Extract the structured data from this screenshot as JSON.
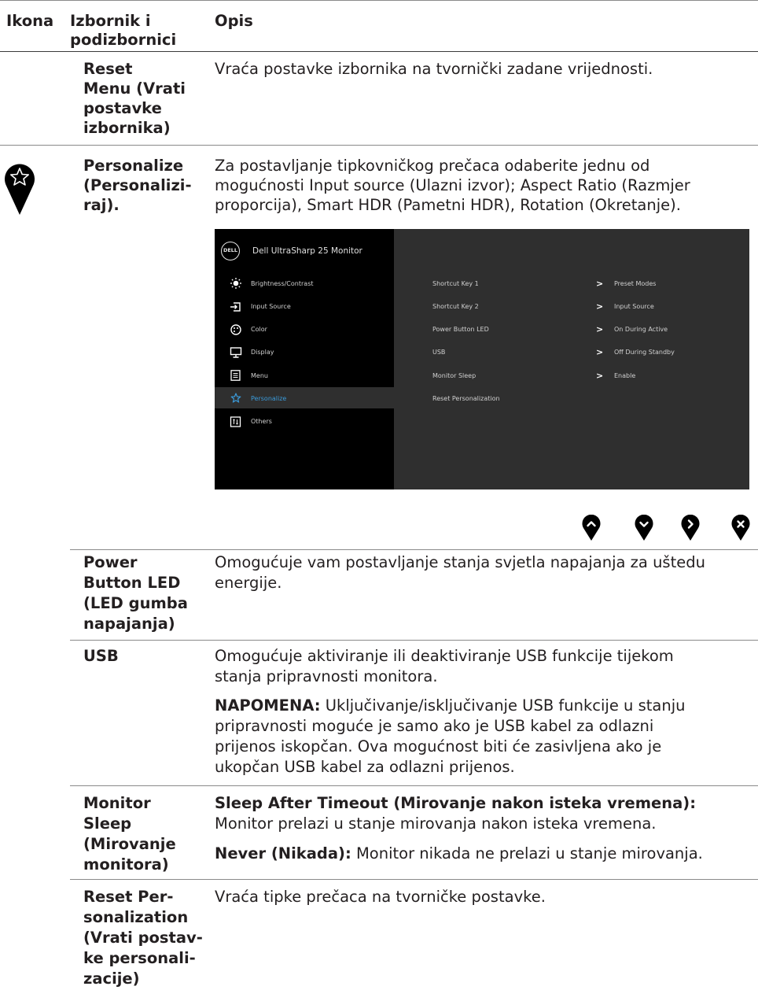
{
  "header": {
    "col_icon": "Ikona",
    "col_menu_line1": "Izbornik i",
    "col_menu_line2": "podizbornici",
    "col_desc": "Opis"
  },
  "rows": {
    "reset_menu": {
      "name": [
        "Reset",
        "Menu (Vrati",
        "postavke",
        "izbornika)"
      ],
      "desc": "Vraća postavke izbornika na tvornički zadane vrijednosti."
    },
    "personalize": {
      "name": [
        "Personalize",
        "(Personalizi-",
        "raj)."
      ],
      "desc": [
        "Za postavljanje tipkovničkog prečaca odaberite jednu od",
        "mogućnosti Input source (Ulazni izvor); Aspect Ratio (Razmjer",
        "proporcija), Smart HDR (Pametni HDR), Rotation (Okretanje)."
      ],
      "icon": "star-icon"
    },
    "power_led": {
      "name": [
        "Power",
        "Button LED",
        "(LED gumba",
        "napajanja)"
      ],
      "desc": [
        "Omogućuje vam postavljanje stanja svjetla napajanja za uštedu",
        "energije."
      ]
    },
    "usb": {
      "name": [
        "USB"
      ],
      "desc": [
        "Omogućuje aktiviranje ili deaktiviranje USB funkcije tijekom",
        "stanja pripravnosti monitora."
      ],
      "note_label": "NAPOMENA:",
      "note": [
        " Uključivanje/isključivanje USB funkcije u stanju",
        "pripravnosti moguće je samo ako je USB kabel za odlazni",
        "prijenos iskopčan. Ova mogućnost biti će zasivljena ako je",
        "ukopčan USB kabel za odlazni prijenos."
      ]
    },
    "monitor_sleep": {
      "name": [
        "Monitor",
        "Sleep",
        "(Mirovanje",
        "monitora)"
      ],
      "opt1_label": "Sleep After Timeout (Mirovanje nakon isteka vremena):",
      "opt1_text": "Monitor prelazi u stanje mirovanja nakon isteka vremena.",
      "opt2_label": "Never (Nikada):",
      "opt2_text": " Monitor nikada ne prelazi u stanje mirovanja."
    },
    "reset_personalization": {
      "name": [
        "Reset Per-",
        "sonalization",
        "(Vrati postav-",
        "ke personali-",
        "zacije)"
      ],
      "desc": "Vraća tipke prečaca na tvorničke postavke."
    }
  },
  "osd": {
    "logo": "DELL",
    "title": "Dell UltraSharp 25 Monitor",
    "menu": [
      {
        "label": "Brightness/Contrast",
        "icon": "sun-icon"
      },
      {
        "label": "Input Source",
        "icon": "input-icon"
      },
      {
        "label": "Color",
        "icon": "palette-icon"
      },
      {
        "label": "Display",
        "icon": "display-icon"
      },
      {
        "label": "Menu",
        "icon": "menu-icon"
      },
      {
        "label": "Personalize",
        "icon": "star-icon",
        "selected": true
      },
      {
        "label": "Others",
        "icon": "others-icon"
      }
    ],
    "settings": [
      {
        "label": "Shortcut Key 1",
        "value": "Preset Modes"
      },
      {
        "label": "Shortcut Key 2",
        "value": "Input Source"
      },
      {
        "label": "Power Button LED",
        "value": "On During Active"
      },
      {
        "label": "USB",
        "value": "Off During Standby"
      },
      {
        "label": "Monitor Sleep",
        "value": "Enable"
      },
      {
        "label": "Reset Personalization",
        "value": ""
      }
    ],
    "accent_color": "#3a9ad9"
  },
  "buttons": [
    "up-button-icon",
    "down-button-icon",
    "right-button-icon",
    "close-button-icon"
  ]
}
